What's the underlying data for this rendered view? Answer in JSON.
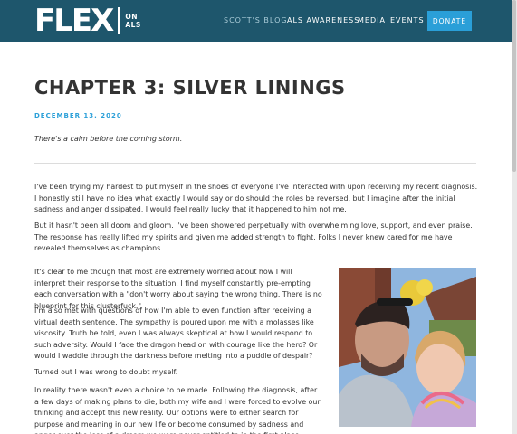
{
  "header": {
    "logo_text": "FLEX",
    "logo_on": "ON",
    "logo_als": "ALS",
    "nav": [
      {
        "label": "SCOTT'S BLOG",
        "active": true
      },
      {
        "label": "ALS AWARENESS",
        "active": false
      },
      {
        "label": "MEDIA",
        "active": false
      },
      {
        "label": "EVENTS",
        "active": false
      }
    ],
    "donate_label": "DONATE"
  },
  "post": {
    "title": "CHAPTER 3: SILVER LININGS",
    "date": "DECEMBER 13, 2020",
    "subtitle": "There's a calm before the coming storm.",
    "paragraphs": [
      "I've been trying my hardest to put myself in the shoes of everyone I've interacted with upon receiving my recent diagnosis. I honestly still have no idea what exactly I would say or do should the roles be reversed, but I imagine after the initial sadness and anger dissipated, I would feel really lucky that it happened to him not me.",
      "But it hasn't been all doom and gloom. I've been showered perpetually with overwhelming love, support, and even praise. The response has really lifted my spirits and given me added strength to fight. Folks I never knew cared for me have revealed themselves as champions.",
      "It's clear to me though that most are extremely worried about how I will interpret their response to the situation. I find myself constantly pre-empting each conversation with a \"don't worry about saying the wrong thing. There is no blueprint for this clusterfuck.\"",
      "I'm also met with questions of how I'm able to even function after receiving a virtual death sentence. The sympathy is poured upon me with a molasses like viscosity. Truth be told, even I was always skeptical at how I would respond to such adversity. Would I face the dragon head on with courage like the hero? Or would I waddle through the darkness before melting into a puddle of despair?",
      "Turned out I was wrong to doubt myself.",
      "In reality there wasn't even a choice to be made. Following the diagnosis, after a few days of making plans to die, both my wife and I were forced to evolve our thinking and accept this new reality. Our options were to either search for purpose and meaning in our new life or become consumed by sadness and anger over the loss of a dream we were never entitled to in the first place. Fortunately, I knew I wasn't likely to die"
    ]
  },
  "colors": {
    "header_bg": "#1e566c",
    "accent": "#2a9fd8"
  }
}
